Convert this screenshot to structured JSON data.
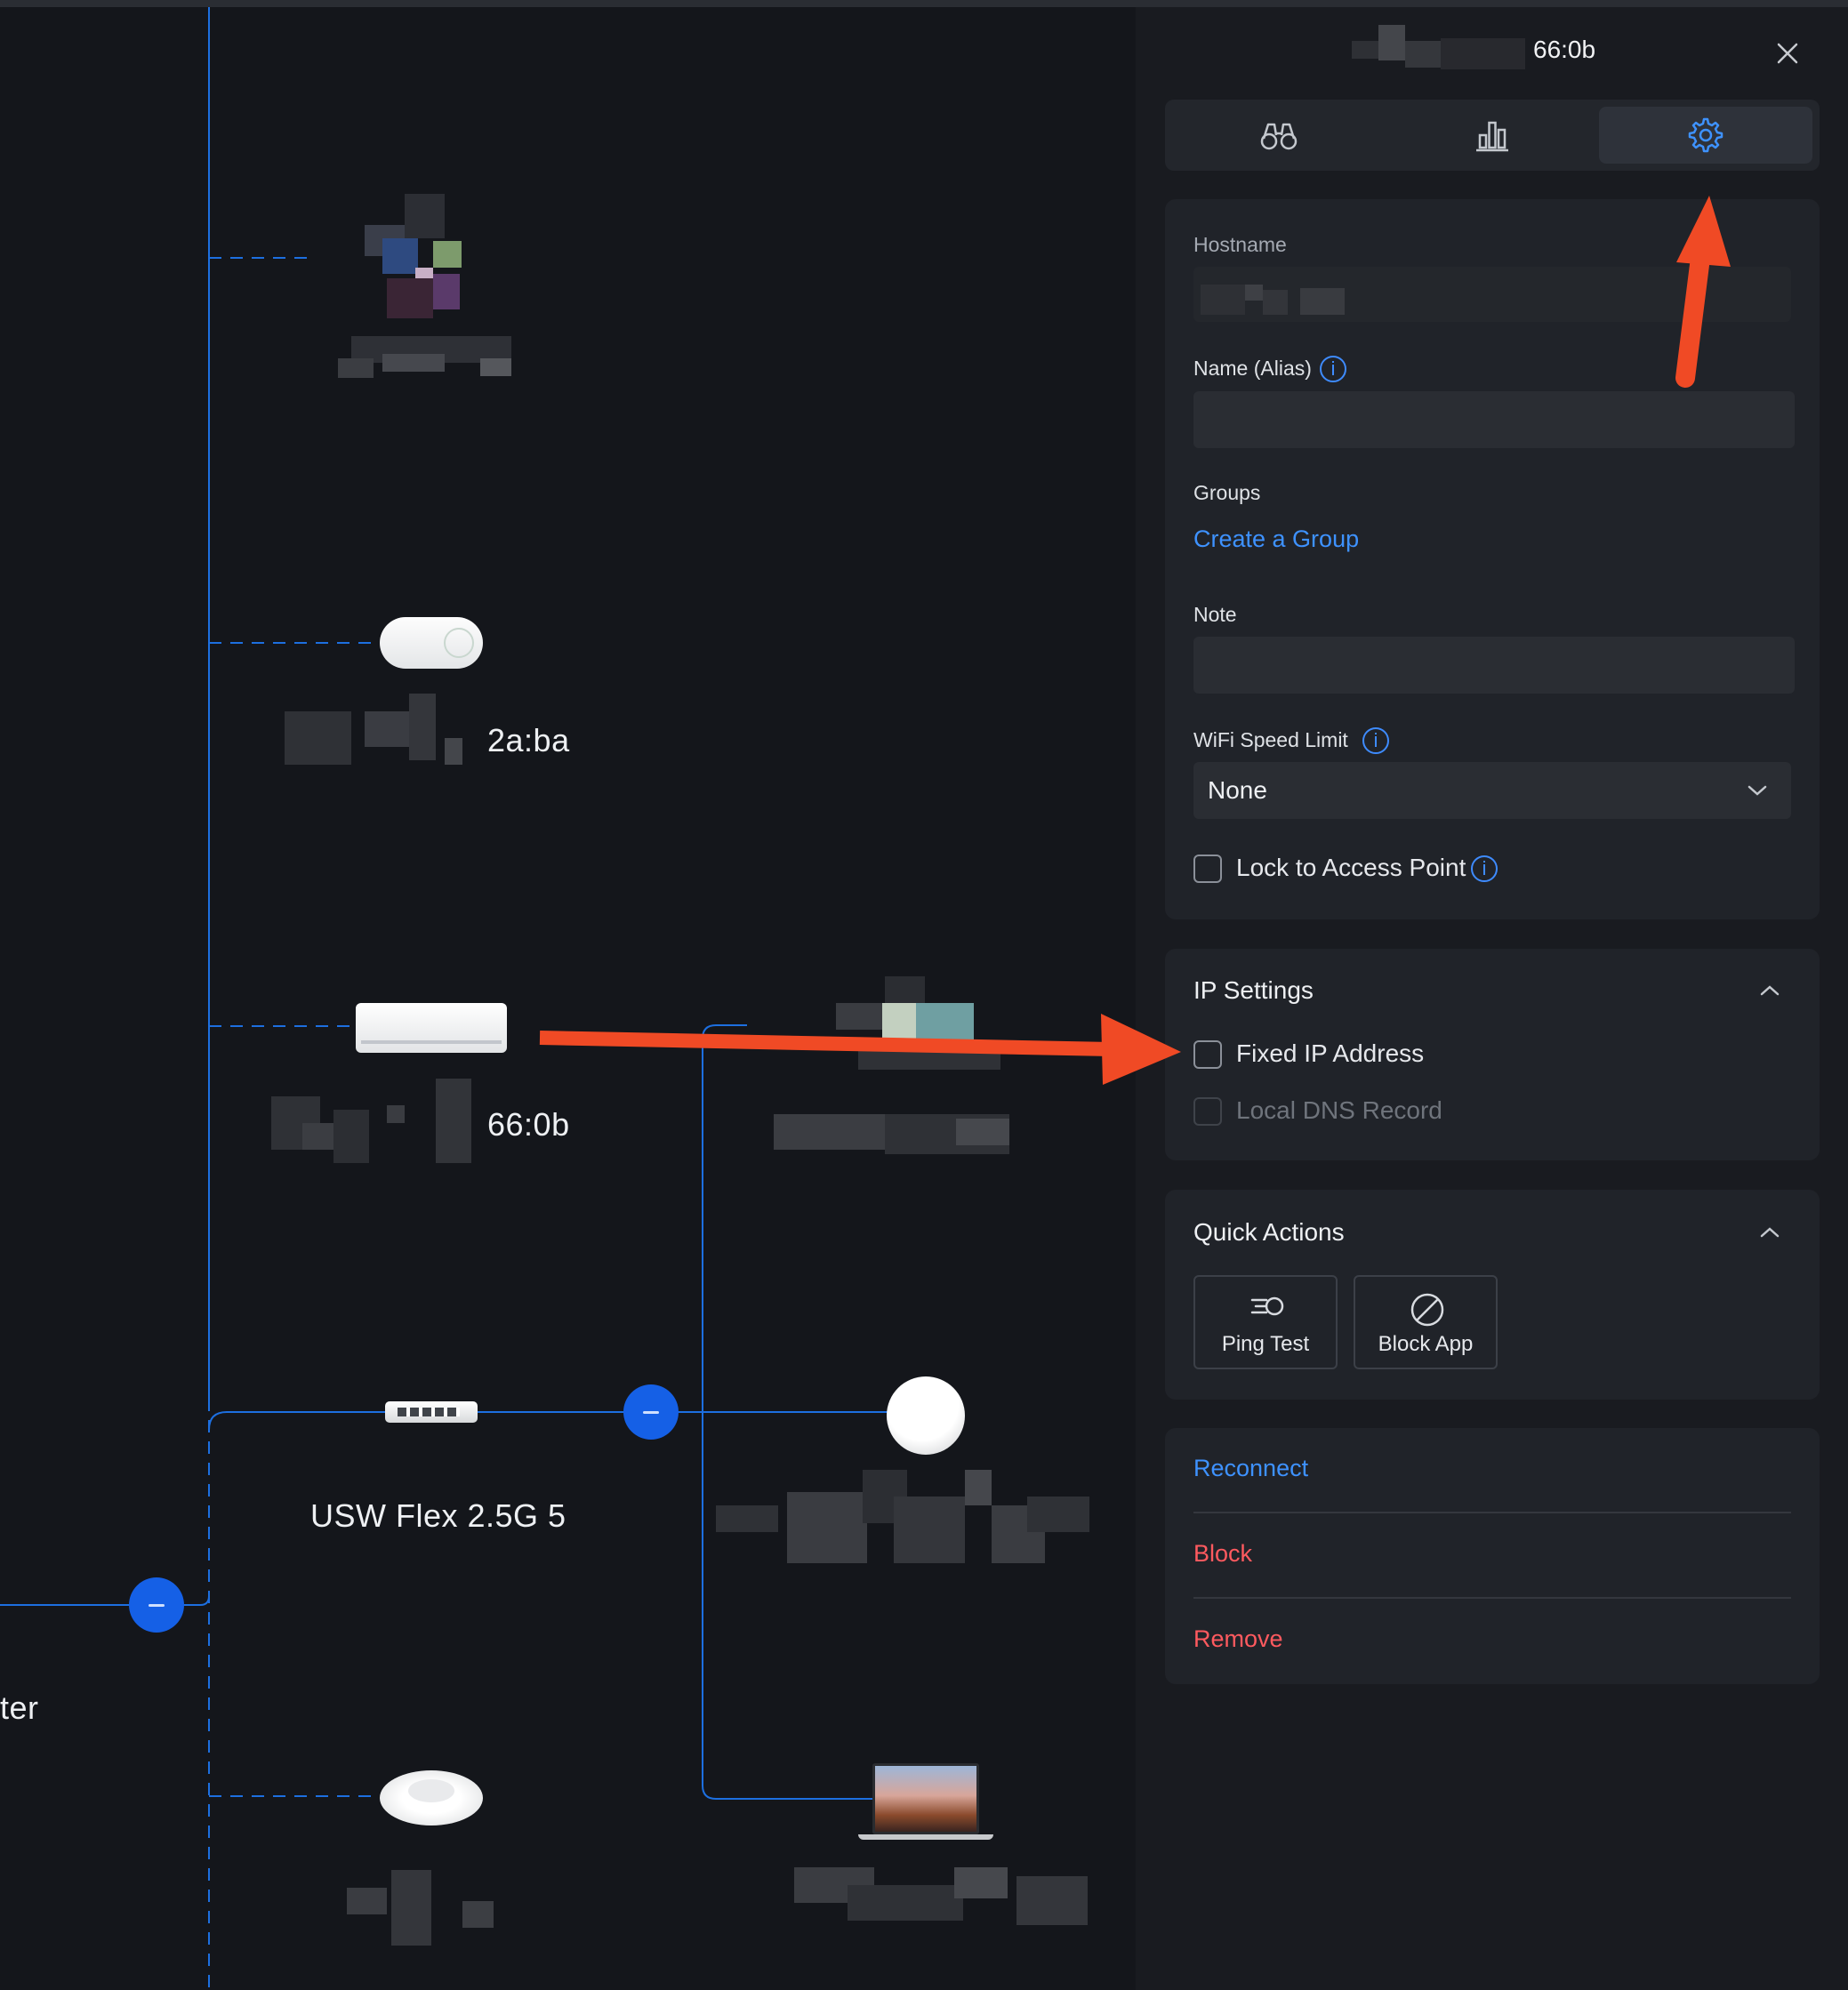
{
  "panel": {
    "title": "66:0b",
    "tabs": [
      {
        "name": "overview",
        "icon": "binoculars-icon"
      },
      {
        "name": "statistics",
        "icon": "bar-chart-icon"
      },
      {
        "name": "settings",
        "icon": "gear-icon",
        "active": true
      }
    ],
    "settings": {
      "hostname_label": "Hostname",
      "alias_label": "Name (Alias)",
      "groups_label": "Groups",
      "create_group_link": "Create a Group",
      "note_label": "Note",
      "wifi_speed_label": "WiFi Speed Limit",
      "wifi_speed_value": "None",
      "lock_ap_label": "Lock to Access Point"
    },
    "ip_settings": {
      "title": "IP Settings",
      "fixed_ip_label": "Fixed IP Address",
      "local_dns_label": "Local DNS Record"
    },
    "quick_actions": {
      "title": "Quick Actions",
      "buttons": [
        {
          "label": "Ping Test",
          "icon": "ping-icon"
        },
        {
          "label": "Block App",
          "icon": "block-icon"
        }
      ]
    },
    "actions": {
      "reconnect": "Reconnect",
      "block": "Block",
      "remove": "Remove"
    }
  },
  "topology": {
    "devices": [
      {
        "label": "2a:ba",
        "icon": "smart-plug-icon"
      },
      {
        "label": "66:0b",
        "icon": "air-conditioner-icon"
      },
      {
        "label": "USW Flex 2.5G 5",
        "icon": "switch-icon"
      },
      {
        "label": "",
        "icon": "access-point-icon"
      },
      {
        "label": "",
        "icon": "round-access-point-icon"
      },
      {
        "label": "",
        "icon": "laptop-icon"
      }
    ],
    "gateway_label_fragment": "ter"
  },
  "colors": {
    "accent": "#3e92ff",
    "danger": "#ff5a5f",
    "annotation_arrow": "#f04a25",
    "link_line": "#1d6fe0"
  }
}
